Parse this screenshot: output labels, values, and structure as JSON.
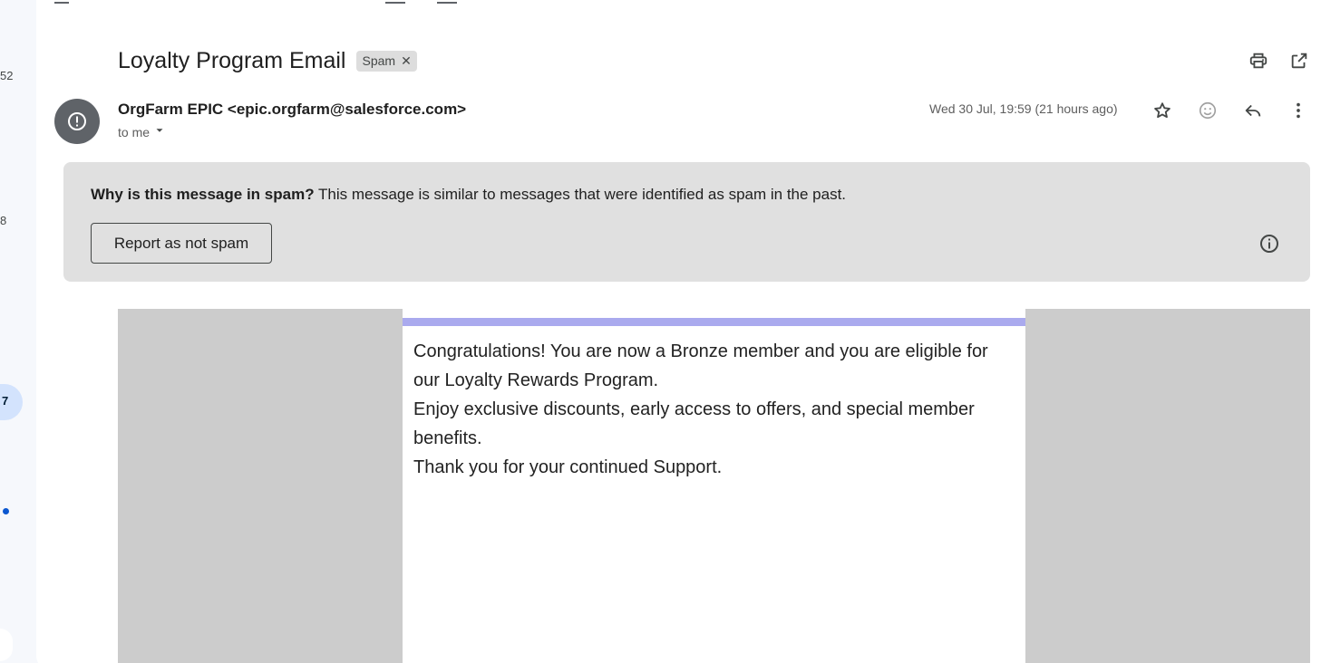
{
  "nav_rail": {
    "counts": [
      "52",
      "8"
    ],
    "active_count": "7"
  },
  "email": {
    "subject": "Loyalty Program Email",
    "label_chip": "Spam",
    "sender": "OrgFarm EPIC <epic.orgfarm@salesforce.com>",
    "recipient": "to me",
    "date": "Wed 30 Jul, 19:59 (21 hours ago)"
  },
  "spam_notice": {
    "heading": "Why is this message in spam?",
    "reason": "This message is similar to messages that were identified as spam in the past.",
    "report_button": "Report as not spam"
  },
  "body": {
    "line1": "Congratulations! You are now a Bronze member and you are eligible for our Loyalty Rewards Program.",
    "line2": "Enjoy exclusive discounts, early access to offers, and special member benefits.",
    "line3": "Thank you for your continued Support."
  },
  "icons": {
    "print": "print-icon",
    "open_new_window": "open-in-new-window-icon",
    "star": "star-icon",
    "emoji": "emoji-reaction-icon",
    "reply": "reply-icon",
    "more": "more-vert-icon",
    "info": "info-icon",
    "spam_avatar": "warning-icon"
  },
  "colors": {
    "accent_bar": "#aaaaee",
    "spam_box_bg": "#e0e0e0",
    "email_bg": "#cccccc",
    "active_rail": "#d3e3fd"
  }
}
